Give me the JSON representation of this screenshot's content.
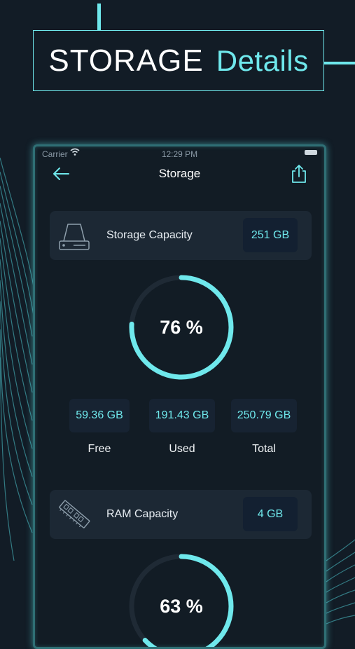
{
  "headline": {
    "strong": "STORAGE",
    "light": "Details"
  },
  "status_bar": {
    "carrier": "Carrier",
    "time": "12:29 PM"
  },
  "nav": {
    "title": "Storage"
  },
  "storage_card": {
    "label": "Storage Capacity",
    "value": "251 GB"
  },
  "storage_ring": {
    "percent_text": "76 %",
    "fraction": 0.76
  },
  "stats": [
    {
      "value": "59.36 GB",
      "caption": "Free"
    },
    {
      "value": "191.43 GB",
      "caption": "Used"
    },
    {
      "value": "250.79 GB",
      "caption": "Total"
    }
  ],
  "ram_card": {
    "label": "RAM Capacity",
    "value": "4 GB"
  },
  "ram_ring": {
    "percent_text": "63 %",
    "fraction": 0.63
  },
  "colors": {
    "accent": "#6fe8ec",
    "background": "#121c26",
    "card": "#1c2834",
    "track": "#1f2a35"
  }
}
